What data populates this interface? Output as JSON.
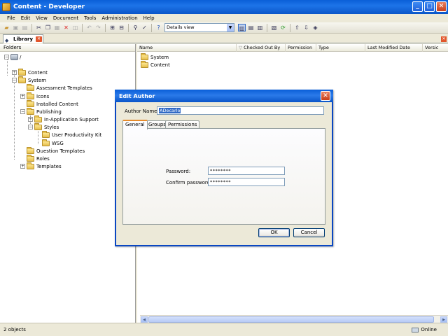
{
  "window": {
    "title": "Content - Developer"
  },
  "menu": [
    "File",
    "Edit",
    "View",
    "Document",
    "Tools",
    "Administration",
    "Help"
  ],
  "toolbar": {
    "view_select": "Details view"
  },
  "tab": {
    "label": "Library"
  },
  "folders": {
    "header": "Folders",
    "root_label": "/",
    "items": [
      {
        "label": "Content",
        "depth": 1
      },
      {
        "label": "System",
        "depth": 1
      },
      {
        "label": "Assessment Templates",
        "depth": 2
      },
      {
        "label": "Icons",
        "depth": 2
      },
      {
        "label": "Installed Content",
        "depth": 2
      },
      {
        "label": "Publishing",
        "depth": 2
      },
      {
        "label": "In-Application Support",
        "depth": 3
      },
      {
        "label": "Styles",
        "depth": 3
      },
      {
        "label": "User Productivity Kit",
        "depth": 4
      },
      {
        "label": "WSG",
        "depth": 4
      },
      {
        "label": "Question Templates",
        "depth": 2
      },
      {
        "label": "Roles",
        "depth": 2
      },
      {
        "label": "Templates",
        "depth": 2
      }
    ]
  },
  "list": {
    "columns": [
      "Name",
      "Checked Out By",
      "Permission",
      "Type",
      "Last Modified Date",
      "Versic"
    ],
    "rows": [
      "System",
      "Content"
    ]
  },
  "status": {
    "count": "2 objects",
    "connection": "Online"
  },
  "dialog": {
    "title": "Edit Author",
    "author_name_label": "Author Name:",
    "author_name_value": "ADecarlo",
    "tabs": [
      "General",
      "Groups",
      "Permissions"
    ],
    "password_label": "Password:",
    "password_value": "********",
    "confirm_label": "Confirm password:",
    "confirm_value": "********",
    "ok_label": "OK",
    "cancel_label": "Cancel"
  }
}
